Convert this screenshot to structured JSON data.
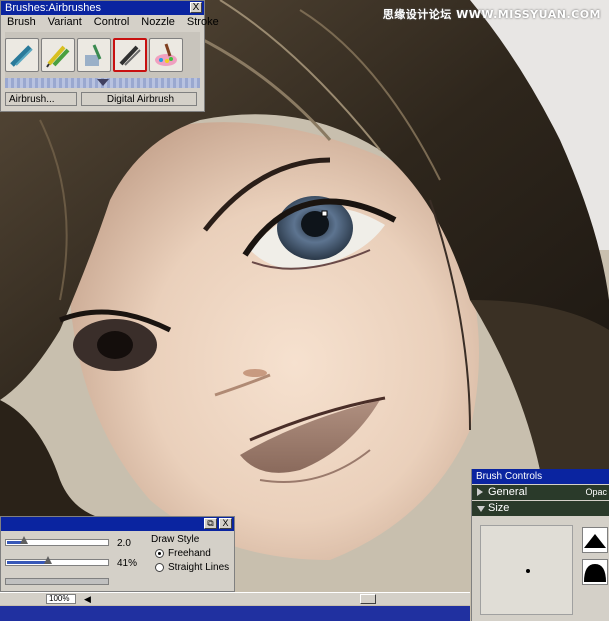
{
  "watermark": "思缘设计论坛 WWW.MISSYUAN.COM",
  "brushes_panel": {
    "title": "Brushes:Airbrushes",
    "close_label": "X",
    "menu": [
      "Brush",
      "Variant",
      "Control",
      "Nozzle",
      "Stroke"
    ],
    "brush_icons": [
      "airbrush-icon",
      "pencils-icon",
      "water-brush-icon",
      "airbrush-selected-icon",
      "palette-brush-icon"
    ],
    "category_value": "Airbrush...",
    "variant_value": "Digital Airbrush"
  },
  "stroke_panel": {
    "restore_label": "⧉",
    "close_label": "X",
    "size_value": "2.0",
    "size_fraction": 0.17,
    "opacity_value": "41%",
    "opacity_fraction": 0.41,
    "draw_style_label": "Draw Style",
    "freehand_label": "Freehand",
    "straight_label": "Straight Lines",
    "selected_style": "Freehand"
  },
  "status_bar": {
    "zoom_value": "100%"
  },
  "brush_controls": {
    "title": "Brush Controls",
    "general_label": "General",
    "general_extra": "Opac",
    "size_label": "Size"
  }
}
